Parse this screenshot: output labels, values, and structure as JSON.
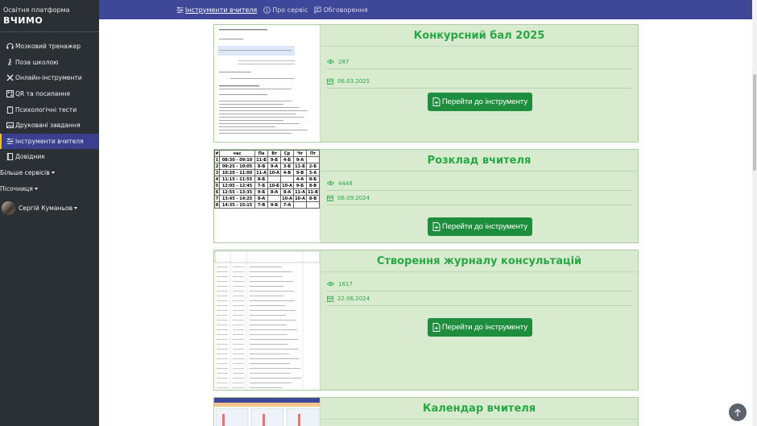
{
  "brand": {
    "subtitle": "Освітня платформа",
    "logo": "ВЧИМО"
  },
  "sidebar": {
    "items": [
      {
        "label": "Мозковий тренажер",
        "icon": "headset-icon"
      },
      {
        "label": "Поза школою",
        "icon": "walking-person-icon"
      },
      {
        "label": "Онлайн-інструменти",
        "icon": "tools-icon"
      },
      {
        "label": "QR та посилання",
        "icon": "qr-code-icon"
      },
      {
        "label": "Психологічні тести",
        "icon": "clipboard-icon"
      },
      {
        "label": "Друковані завдання",
        "icon": "picture-icon"
      },
      {
        "label": "Інструменти вчителя",
        "icon": "sliders-icon",
        "active": true
      },
      {
        "label": "Довідник",
        "icon": "book-icon"
      }
    ],
    "more_services": "Більше сервісів",
    "sandbox": "Пісочниця",
    "user_name": "Сергій Куманьов"
  },
  "topbar": {
    "links": [
      {
        "label": "Інструменти вчителя",
        "active": true
      },
      {
        "label": "Про сервіс"
      },
      {
        "label": "Обговорення"
      }
    ]
  },
  "cards": [
    {
      "title": "Конкурсний бал 2025",
      "views": "287",
      "date": "06.03.2025",
      "button": "Перейти до інструменту"
    },
    {
      "title": "Розклад вчителя",
      "views": "4448",
      "date": "06.09.2024",
      "button": "Перейти до інструменту"
    },
    {
      "title": "Створення журналу консультацій",
      "views": "1617",
      "date": "22.06.2024",
      "button": "Перейти до інструменту"
    },
    {
      "title": "Календар вчителя"
    }
  ],
  "schedule_thumb": {
    "headers": [
      "#",
      "час",
      "Пн",
      "Вт",
      "Ср",
      "Чт",
      "Пт"
    ],
    "rows": [
      [
        "1",
        "08:30 - 09:10",
        "11-Б",
        "9-Б",
        "4-Б",
        "9-А",
        ""
      ],
      [
        "2",
        "09:25 - 10:05",
        "8-В",
        "9-А",
        "3-Б",
        "11-Б",
        "2-Б"
      ],
      [
        "3",
        "10:20 - 11:00",
        "11-А",
        "10-А",
        "4-В",
        "9-В",
        "3-А"
      ],
      [
        "4",
        "11:15 - 11:55",
        "8-Б",
        "",
        "",
        "4-А",
        "8-Б"
      ],
      [
        "5",
        "12:05 - 12:45",
        "7-Б",
        "10-Б",
        "10-А",
        "9-Б",
        "8-В"
      ],
      [
        "6",
        "12:55 - 13:35",
        "9-Б",
        "8-А",
        "8-А",
        "11-А",
        "11-В"
      ],
      [
        "7",
        "13:45 - 14:25",
        "8-А",
        "",
        "10-А",
        "10-А",
        "8-В"
      ],
      [
        "8",
        "14:35 - 15:15",
        "7-В",
        "9-Б",
        "7-А",
        "",
        ""
      ]
    ]
  },
  "colors": {
    "accent": "#3f4799",
    "sidebar": "#2b3035",
    "card_bg": "#d8ebcf",
    "title_green": "#28a745",
    "button_green": "#1e8e3e"
  }
}
